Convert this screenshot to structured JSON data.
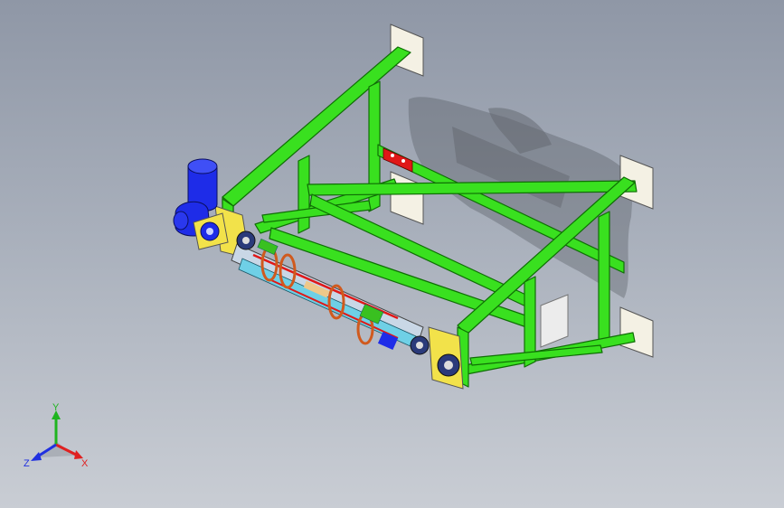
{
  "viewport": {
    "background_top": "#8f97a6",
    "background_bottom": "#c9cdd4"
  },
  "model": {
    "frame_color": "#39e01f",
    "frame_edge": "#0f6e05",
    "motor_color": "#1e2ce8",
    "plate_color": "#f4f1e4",
    "bracket_color": "#f2e24a",
    "shadow_color": "#3f4349"
  },
  "triad": {
    "x_label": "X",
    "y_label": "Y",
    "z_label": "Z",
    "x_color": "#e02020",
    "y_color": "#1fb41f",
    "z_color": "#2030e0"
  }
}
